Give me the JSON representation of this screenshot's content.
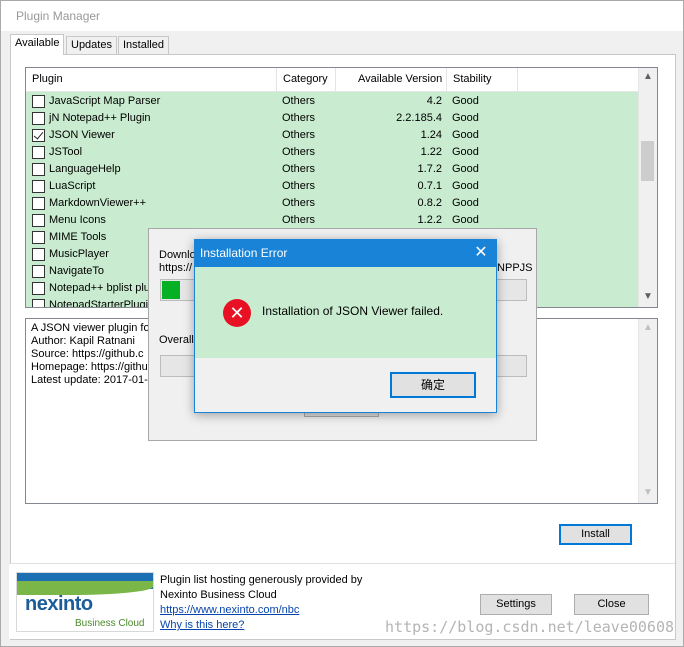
{
  "window": {
    "title": "Plugin Manager"
  },
  "tabs": [
    {
      "label": "Available"
    },
    {
      "label": "Updates"
    },
    {
      "label": "Installed"
    }
  ],
  "plugin_list": {
    "columns": [
      "Plugin",
      "Category",
      "Available Version",
      "Stability"
    ],
    "rows": [
      {
        "name": "JavaScript Map Parser",
        "category": "Others",
        "version": "4.2",
        "stability": "Good",
        "checked": false
      },
      {
        "name": "jN Notepad++ Plugin",
        "category": "Others",
        "version": "2.2.185.4",
        "stability": "Good",
        "checked": false
      },
      {
        "name": "JSON Viewer",
        "category": "Others",
        "version": "1.24",
        "stability": "Good",
        "checked": true
      },
      {
        "name": "JSTool",
        "category": "Others",
        "version": "1.22",
        "stability": "Good",
        "checked": false
      },
      {
        "name": "LanguageHelp",
        "category": "Others",
        "version": "1.7.2",
        "stability": "Good",
        "checked": false
      },
      {
        "name": "LuaScript",
        "category": "Others",
        "version": "0.7.1",
        "stability": "Good",
        "checked": false
      },
      {
        "name": "MarkdownViewer++",
        "category": "Others",
        "version": "0.8.2",
        "stability": "Good",
        "checked": false
      },
      {
        "name": "Menu Icons",
        "category": "Others",
        "version": "1.2.2",
        "stability": "Good",
        "checked": false
      },
      {
        "name": "MIME Tools",
        "category": "",
        "version": "",
        "stability": "",
        "checked": false
      },
      {
        "name": "MusicPlayer",
        "category": "",
        "version": "",
        "stability": "",
        "checked": false
      },
      {
        "name": "NavigateTo",
        "category": "",
        "version": "",
        "stability": "",
        "checked": false
      },
      {
        "name": "Notepad++ bplist plu",
        "category": "",
        "version": "",
        "stability": "",
        "checked": false
      },
      {
        "name": "NotepadStarterPlugin",
        "category": "",
        "version": "",
        "stability": "",
        "checked": false
      }
    ]
  },
  "description": {
    "lines": [
      "A JSON viewer plugin for",
      "Author: Kapil Ratnani",
      "Source: https://github.c",
      "Homepage: https://githu",
      "Latest update: 2017-01-"
    ]
  },
  "buttons": {
    "install": "Install",
    "settings": "Settings",
    "close": "Close"
  },
  "footer": {
    "line1": "Plugin list hosting generously provided by",
    "line2": "Nexinto Business Cloud",
    "link1": "https://www.nexinto.com/nbc",
    "link2": "Why is this here?",
    "logo_main": "nexinto",
    "logo_sub": "Business Cloud"
  },
  "download_dialog": {
    "label_line1": "Downlo",
    "label_line2": "https://",
    "url_tail": "/NPPJS",
    "overall": "Overall",
    "progress": 0.05
  },
  "error_dialog": {
    "title": "Installation Error",
    "message": "Installation of JSON Viewer failed.",
    "ok": "确定"
  },
  "watermark": "https://blog.csdn.net/leave00608",
  "colors": {
    "highlight_row": "#c9ecd0",
    "accent": "#1883d7",
    "error": "#e81123",
    "progress": "#06b025"
  }
}
